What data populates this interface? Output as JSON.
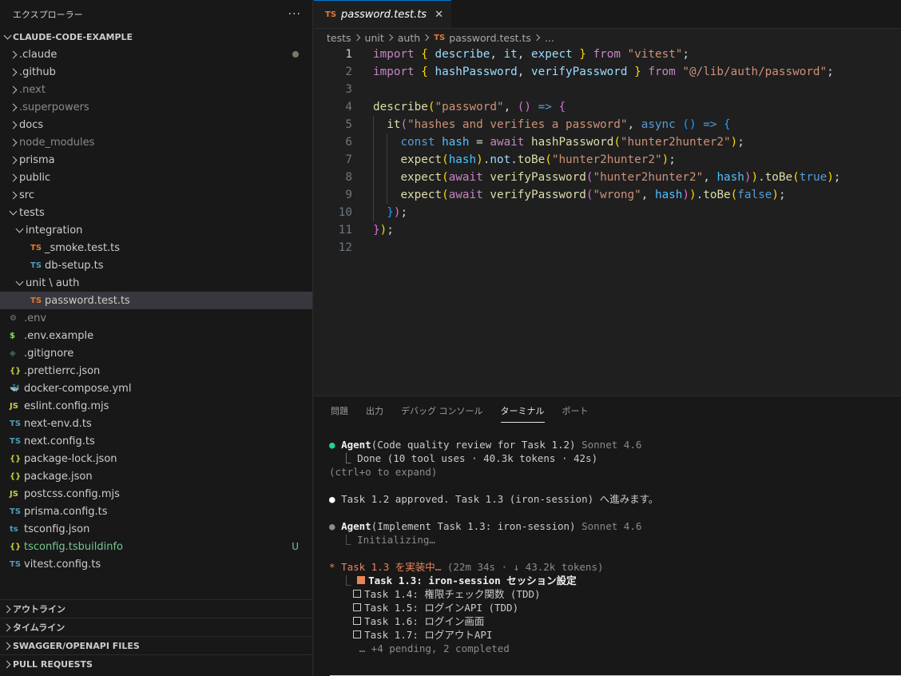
{
  "sidebar": {
    "title": "エクスプローラー",
    "more": "···",
    "root": "CLAUDE-CODE-EXAMPLE",
    "items": [
      {
        "label": ".claude",
        "indent": 0,
        "chevron": "right",
        "icon": "",
        "icon_color": "",
        "dim": false,
        "decoration": "dot"
      },
      {
        "label": ".github",
        "indent": 0,
        "chevron": "right",
        "icon": "",
        "icon_color": "",
        "dim": false,
        "decoration": ""
      },
      {
        "label": ".next",
        "indent": 0,
        "chevron": "right",
        "icon": "",
        "icon_color": "",
        "dim": true,
        "decoration": ""
      },
      {
        "label": ".superpowers",
        "indent": 0,
        "chevron": "right",
        "icon": "",
        "icon_color": "",
        "dim": true,
        "decoration": ""
      },
      {
        "label": "docs",
        "indent": 0,
        "chevron": "right",
        "icon": "",
        "icon_color": "",
        "dim": false,
        "decoration": ""
      },
      {
        "label": "node_modules",
        "indent": 0,
        "chevron": "right",
        "icon": "",
        "icon_color": "",
        "dim": true,
        "decoration": ""
      },
      {
        "label": "prisma",
        "indent": 0,
        "chevron": "right",
        "icon": "",
        "icon_color": "",
        "dim": false,
        "decoration": ""
      },
      {
        "label": "public",
        "indent": 0,
        "chevron": "right",
        "icon": "",
        "icon_color": "",
        "dim": false,
        "decoration": ""
      },
      {
        "label": "src",
        "indent": 0,
        "chevron": "right",
        "icon": "",
        "icon_color": "",
        "dim": false,
        "decoration": ""
      },
      {
        "label": "tests",
        "indent": 0,
        "chevron": "down",
        "icon": "",
        "icon_color": "",
        "dim": false,
        "decoration": ""
      },
      {
        "label": "integration",
        "indent": 1,
        "chevron": "down",
        "icon": "",
        "icon_color": "",
        "dim": false,
        "decoration": ""
      },
      {
        "label": "_smoke.test.ts",
        "indent": 2,
        "chevron": "",
        "icon": "TS",
        "icon_color": "#e37933",
        "dim": false,
        "decoration": ""
      },
      {
        "label": "db-setup.ts",
        "indent": 2,
        "chevron": "",
        "icon": "TS",
        "icon_color": "#519aba",
        "dim": false,
        "decoration": ""
      },
      {
        "label": "unit \\ auth",
        "indent": 1,
        "chevron": "down",
        "icon": "",
        "icon_color": "",
        "dim": false,
        "decoration": ""
      },
      {
        "label": "password.test.ts",
        "indent": 2,
        "chevron": "",
        "icon": "TS",
        "icon_color": "#e37933",
        "dim": false,
        "decoration": "",
        "selected": true
      },
      {
        "label": ".env",
        "indent": 0,
        "chevron": "",
        "icon": "⚙",
        "icon_color": "#6d8086",
        "dim": true,
        "decoration": ""
      },
      {
        "label": ".env.example",
        "indent": 0,
        "chevron": "",
        "icon": "$",
        "icon_color": "#89e051",
        "dim": false,
        "decoration": ""
      },
      {
        "label": ".gitignore",
        "indent": 0,
        "chevron": "",
        "icon": "◆",
        "icon_color": "#41535b",
        "dim": false,
        "decoration": ""
      },
      {
        "label": ".prettierrc.json",
        "indent": 0,
        "chevron": "",
        "icon": "{}",
        "icon_color": "#cbcb41",
        "dim": false,
        "decoration": ""
      },
      {
        "label": "docker-compose.yml",
        "indent": 0,
        "chevron": "",
        "icon": "🐳",
        "icon_color": "#e0505a",
        "dim": false,
        "decoration": ""
      },
      {
        "label": "eslint.config.mjs",
        "indent": 0,
        "chevron": "",
        "icon": "JS",
        "icon_color": "#cbcb41",
        "dim": false,
        "decoration": ""
      },
      {
        "label": "next-env.d.ts",
        "indent": 0,
        "chevron": "",
        "icon": "TS",
        "icon_color": "#519aba",
        "dim": false,
        "decoration": ""
      },
      {
        "label": "next.config.ts",
        "indent": 0,
        "chevron": "",
        "icon": "TS",
        "icon_color": "#519aba",
        "dim": false,
        "decoration": ""
      },
      {
        "label": "package-lock.json",
        "indent": 0,
        "chevron": "",
        "icon": "{}",
        "icon_color": "#cbcb41",
        "dim": false,
        "decoration": ""
      },
      {
        "label": "package.json",
        "indent": 0,
        "chevron": "",
        "icon": "{}",
        "icon_color": "#cbcb41",
        "dim": false,
        "decoration": ""
      },
      {
        "label": "postcss.config.mjs",
        "indent": 0,
        "chevron": "",
        "icon": "JS",
        "icon_color": "#cbcb41",
        "dim": false,
        "decoration": ""
      },
      {
        "label": "prisma.config.ts",
        "indent": 0,
        "chevron": "",
        "icon": "TS",
        "icon_color": "#519aba",
        "dim": false,
        "decoration": ""
      },
      {
        "label": "tsconfig.json",
        "indent": 0,
        "chevron": "",
        "icon": "ts",
        "icon_color": "#519aba",
        "dim": false,
        "decoration": ""
      },
      {
        "label": "tsconfig.tsbuildinfo",
        "indent": 0,
        "chevron": "",
        "icon": "{}",
        "icon_color": "#cbcb41",
        "dim": false,
        "decoration": "U",
        "label_color": "#73c991"
      },
      {
        "label": "vitest.config.ts",
        "indent": 0,
        "chevron": "",
        "icon": "TS",
        "icon_color": "#519aba",
        "dim": false,
        "decoration": ""
      }
    ],
    "sections": [
      "アウトライン",
      "タイムライン",
      "SWAGGER/OPENAPI FILES",
      "PULL REQUESTS"
    ]
  },
  "editor": {
    "tab": {
      "icon": "TS",
      "label": "password.test.ts",
      "close": "✕"
    },
    "breadcrumbs": [
      "tests",
      "unit",
      "auth",
      "password.test.ts",
      "..."
    ],
    "breadcrumb_icon": "TS",
    "current_line": 1,
    "lines": [
      [
        [
          "import ",
          "k"
        ],
        [
          "{ ",
          "y"
        ],
        [
          "describe",
          "v"
        ],
        [
          ", ",
          "p"
        ],
        [
          "it",
          "v"
        ],
        [
          ", ",
          "p"
        ],
        [
          "expect",
          "v"
        ],
        [
          " }",
          "y"
        ],
        [
          " from ",
          "k"
        ],
        [
          "\"vitest\"",
          "s"
        ],
        [
          ";",
          "p"
        ]
      ],
      [
        [
          "import ",
          "k"
        ],
        [
          "{ ",
          "y"
        ],
        [
          "hashPassword",
          "v"
        ],
        [
          ", ",
          "p"
        ],
        [
          "verifyPassword",
          "v"
        ],
        [
          " }",
          "y"
        ],
        [
          " from ",
          "k"
        ],
        [
          "\"@/lib/auth/password\"",
          "s"
        ],
        [
          ";",
          "p"
        ]
      ],
      [],
      [
        [
          "describe",
          "f"
        ],
        [
          "(",
          "y"
        ],
        [
          "\"password\"",
          "s"
        ],
        [
          ", ",
          "p"
        ],
        [
          "()",
          "pk"
        ],
        [
          " => ",
          "b"
        ],
        [
          "{",
          "pk"
        ]
      ],
      [
        [
          "  ",
          "p"
        ],
        [
          "it",
          "f"
        ],
        [
          "(",
          "pk"
        ],
        [
          "\"hashes and verifies a password\"",
          "s"
        ],
        [
          ", ",
          "p"
        ],
        [
          "async ",
          "b"
        ],
        [
          "()",
          "bl"
        ],
        [
          " => ",
          "b"
        ],
        [
          "{",
          "bl"
        ]
      ],
      [
        [
          "    ",
          "p"
        ],
        [
          "const ",
          "b"
        ],
        [
          "hash",
          "c"
        ],
        [
          " = ",
          "p"
        ],
        [
          "await ",
          "k"
        ],
        [
          "hashPassword",
          "f"
        ],
        [
          "(",
          "y"
        ],
        [
          "\"hunter2hunter2\"",
          "s"
        ],
        [
          ")",
          "y"
        ],
        [
          ";",
          "p"
        ]
      ],
      [
        [
          "    ",
          "p"
        ],
        [
          "expect",
          "f"
        ],
        [
          "(",
          "y"
        ],
        [
          "hash",
          "c"
        ],
        [
          ")",
          "y"
        ],
        [
          ".",
          "p"
        ],
        [
          "not",
          "v"
        ],
        [
          ".",
          "p"
        ],
        [
          "toBe",
          "f"
        ],
        [
          "(",
          "y"
        ],
        [
          "\"hunter2hunter2\"",
          "s"
        ],
        [
          ")",
          "y"
        ],
        [
          ";",
          "p"
        ]
      ],
      [
        [
          "    ",
          "p"
        ],
        [
          "expect",
          "f"
        ],
        [
          "(",
          "y"
        ],
        [
          "await ",
          "k"
        ],
        [
          "verifyPassword",
          "f"
        ],
        [
          "(",
          "pk"
        ],
        [
          "\"hunter2hunter2\"",
          "s"
        ],
        [
          ", ",
          "p"
        ],
        [
          "hash",
          "c"
        ],
        [
          ")",
          "pk"
        ],
        [
          ")",
          "y"
        ],
        [
          ".",
          "p"
        ],
        [
          "toBe",
          "f"
        ],
        [
          "(",
          "y"
        ],
        [
          "true",
          "b"
        ],
        [
          ")",
          "y"
        ],
        [
          ";",
          "p"
        ]
      ],
      [
        [
          "    ",
          "p"
        ],
        [
          "expect",
          "f"
        ],
        [
          "(",
          "y"
        ],
        [
          "await ",
          "k"
        ],
        [
          "verifyPassword",
          "f"
        ],
        [
          "(",
          "pk"
        ],
        [
          "\"wrong\"",
          "s"
        ],
        [
          ", ",
          "p"
        ],
        [
          "hash",
          "c"
        ],
        [
          ")",
          "pk"
        ],
        [
          ")",
          "y"
        ],
        [
          ".",
          "p"
        ],
        [
          "toBe",
          "f"
        ],
        [
          "(",
          "y"
        ],
        [
          "false",
          "b"
        ],
        [
          ")",
          "y"
        ],
        [
          ";",
          "p"
        ]
      ],
      [
        [
          "  ",
          "p"
        ],
        [
          "}",
          "bl"
        ],
        [
          ")",
          "pk"
        ],
        [
          ";",
          "p"
        ]
      ],
      [
        [
          "}",
          "pk"
        ],
        [
          ")",
          "y"
        ],
        [
          ";",
          "p"
        ]
      ],
      []
    ]
  },
  "panel": {
    "tabs": [
      "問題",
      "出力",
      "デバッグ コンソール",
      "ターミナル",
      "ポート"
    ],
    "active_tab": 3,
    "terminal": [
      [
        [
          "● ",
          "green"
        ],
        [
          "Agent",
          "bold"
        ],
        [
          "(Code quality review for Task 1.2) ",
          ""
        ],
        [
          "Sonnet 4.6",
          "grey"
        ]
      ],
      [
        [
          "  ⎿ Done (10 tool uses · 40.3k tokens · 42s)",
          ""
        ]
      ],
      [
        [
          "(ctrl+o to expand)",
          "grey"
        ]
      ],
      [],
      [
        [
          "● ",
          "white"
        ],
        [
          "Task 1.2 approved. Task 1.3 (iron-session) へ進みます。",
          ""
        ]
      ],
      [],
      [
        [
          "● ",
          "grey"
        ],
        [
          "Agent",
          "bold"
        ],
        [
          "(Implement Task 1.3: iron-session) ",
          ""
        ],
        [
          "Sonnet 4.6",
          "grey"
        ]
      ],
      [
        [
          "  ⎿ Initializing…",
          "grey"
        ]
      ],
      [],
      [
        [
          "* Task 1.3 を実装中… ",
          "orange"
        ],
        [
          "(22m 34s · ↓ 43.2k tokens)",
          "grey"
        ]
      ],
      [
        [
          "  ⎿ ",
          "grey"
        ],
        [
          "■",
          "sqfill"
        ],
        [
          "Task 1.3: iron-session セッション設定",
          "bold"
        ]
      ],
      [
        [
          "    ",
          ""
        ],
        [
          "□",
          "sq"
        ],
        [
          "Task 1.4: 権限チェック関数 (TDD)",
          ""
        ]
      ],
      [
        [
          "    ",
          ""
        ],
        [
          "□",
          "sq"
        ],
        [
          "Task 1.5: ログインAPI (TDD)",
          ""
        ]
      ],
      [
        [
          "    ",
          ""
        ],
        [
          "□",
          "sq"
        ],
        [
          "Task 1.6: ログイン画面",
          ""
        ]
      ],
      [
        [
          "    ",
          ""
        ],
        [
          "□",
          "sq"
        ],
        [
          "Task 1.7: ログアウトAPI",
          ""
        ]
      ],
      [
        [
          "     … +4 pending, 2 completed",
          "grey"
        ]
      ]
    ]
  }
}
